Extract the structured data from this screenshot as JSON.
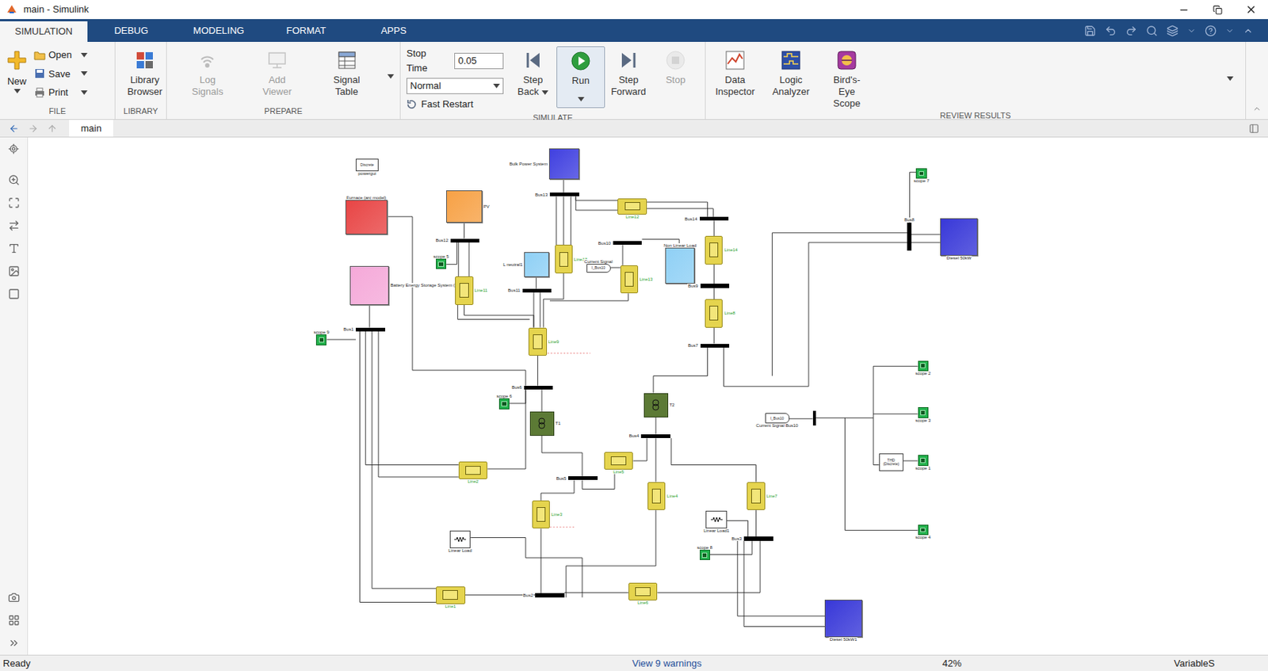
{
  "window": {
    "title": "main - Simulink"
  },
  "tabs": [
    {
      "label": "SIMULATION",
      "selected": true
    },
    {
      "label": "DEBUG",
      "selected": false
    },
    {
      "label": "MODELING",
      "selected": false
    },
    {
      "label": "FORMAT",
      "selected": false
    },
    {
      "label": "APPS",
      "selected": false
    }
  ],
  "ribbon": {
    "file": {
      "label": "FILE",
      "new": "New",
      "items": [
        "Open",
        "Save",
        "Print"
      ]
    },
    "library": {
      "label": "LIBRARY",
      "button": "Library Browser"
    },
    "prepare": {
      "label": "PREPARE",
      "buttons": [
        {
          "label": "Log Signals",
          "disabled": true
        },
        {
          "label": "Add Viewer",
          "disabled": true
        },
        {
          "label": "Signal Table",
          "disabled": false
        }
      ]
    },
    "simulate": {
      "label": "SIMULATE",
      "stop_time_label": "Stop Time",
      "stop_time": "0.05",
      "mode": "Normal",
      "fast_restart": "Fast Restart",
      "buttons": [
        {
          "label": "Step Back",
          "disabled": false,
          "menu": true
        },
        {
          "label": "Run",
          "disabled": false,
          "menu": true
        },
        {
          "label": "Step Forward",
          "disabled": false,
          "menu": false
        },
        {
          "label": "Stop",
          "disabled": true,
          "menu": false
        }
      ]
    },
    "review": {
      "label": "REVIEW RESULTS",
      "buttons": [
        "Data Inspector",
        "Logic Analyzer",
        "Bird's-Eye Scope"
      ]
    }
  },
  "breadcrumb": {
    "tab": "main"
  },
  "diagram": {
    "blocks": [
      {
        "kind": "powergui",
        "text": "Discrete",
        "label": "powergui"
      },
      {
        "kind": "source",
        "label": "Furnace (arc model)",
        "color": "#e84545"
      },
      {
        "kind": "source",
        "label": "PV",
        "color": "#f7a145"
      },
      {
        "kind": "source",
        "label": "Bulk Power System",
        "color": "#4040e0"
      },
      {
        "kind": "source",
        "label": "Battery Energy Storage System (BESS)",
        "color": "#f5a9d9"
      },
      {
        "kind": "source",
        "label": "L neutral1",
        "color": "#8fd0f5"
      },
      {
        "kind": "source",
        "label": "Non Linear Load",
        "color": "#8fd0f5"
      },
      {
        "kind": "source",
        "label": "Diesel 50kW",
        "color": "#3838d8"
      },
      {
        "kind": "source",
        "label": "Diesel 50kW1",
        "color": "#3838d8"
      },
      {
        "kind": "transformer",
        "label": "T1"
      },
      {
        "kind": "transformer",
        "label": "T2"
      },
      {
        "kind": "line",
        "label": "Line11"
      },
      {
        "kind": "line",
        "label": "Line17"
      },
      {
        "kind": "line",
        "label": "Line9"
      },
      {
        "kind": "line",
        "label": "Line13"
      },
      {
        "kind": "line",
        "label": "Line12"
      },
      {
        "kind": "line",
        "label": "Line14"
      },
      {
        "kind": "line",
        "label": "Line8"
      },
      {
        "kind": "line",
        "label": "Line2"
      },
      {
        "kind": "line",
        "label": "Line5"
      },
      {
        "kind": "line",
        "label": "Line3"
      },
      {
        "kind": "line",
        "label": "Line4"
      },
      {
        "kind": "line",
        "label": "Line7"
      },
      {
        "kind": "line",
        "label": "Line1"
      },
      {
        "kind": "line",
        "label": "Line6"
      },
      {
        "kind": "bus",
        "label": "Bus13"
      },
      {
        "kind": "bus",
        "label": "Bus12"
      },
      {
        "kind": "bus",
        "label": "Bus1"
      },
      {
        "kind": "bus",
        "label": "Bus11"
      },
      {
        "kind": "bus",
        "label": "Bus10"
      },
      {
        "kind": "bus",
        "label": "Bus14"
      },
      {
        "kind": "bus",
        "label": "Bus9"
      },
      {
        "kind": "bus",
        "label": "Bus7"
      },
      {
        "kind": "bus",
        "label": "Bus6"
      },
      {
        "kind": "bus",
        "label": "Bus4"
      },
      {
        "kind": "bus",
        "label": "Bus5"
      },
      {
        "kind": "bus",
        "label": "Bus3"
      },
      {
        "kind": "bus",
        "label": "Bus2"
      },
      {
        "kind": "bus",
        "label": "Bus8"
      },
      {
        "kind": "scope",
        "label": "scope 7"
      },
      {
        "kind": "scope",
        "label": "scope 5"
      },
      {
        "kind": "scope",
        "label": "scope 9"
      },
      {
        "kind": "scope",
        "label": "scope 6"
      },
      {
        "kind": "scope",
        "label": "scope 2"
      },
      {
        "kind": "scope",
        "label": "scope 3"
      },
      {
        "kind": "scope",
        "label": "scope 1"
      },
      {
        "kind": "scope",
        "label": "scope 4"
      },
      {
        "kind": "scope",
        "label": "scope 8"
      },
      {
        "kind": "load",
        "label": "Linear Load"
      },
      {
        "kind": "load",
        "label": "Linear Load1"
      },
      {
        "kind": "tag",
        "text": "I_Bus10",
        "label": "Current Signal"
      },
      {
        "kind": "tag",
        "text": "I_Bus10",
        "label": "Current Signal Bus10"
      },
      {
        "kind": "thd",
        "text": "THD (Discrete)"
      },
      {
        "kind": "mux"
      }
    ]
  },
  "status_bar": {
    "status": "Ready",
    "warnings": "View 9 warnings",
    "zoom": "42%",
    "solver": "VariableS"
  }
}
